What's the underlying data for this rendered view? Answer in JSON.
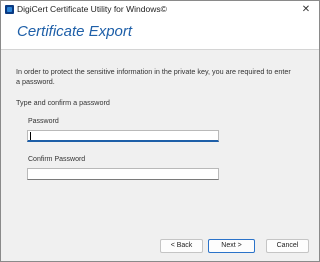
{
  "window": {
    "title": "DigiCert Certificate Utility for Windows©",
    "close_glyph": "✕"
  },
  "header": {
    "title": "Certificate Export"
  },
  "body": {
    "intro": "In order to protect the sensitive information in the private key, you are required to enter a password.",
    "instruction": "Type and confirm a password"
  },
  "form": {
    "password_label": "Password",
    "password_value": "",
    "confirm_label": "Confirm Password",
    "confirm_value": ""
  },
  "buttons": {
    "back": "< Back",
    "next": "Next >",
    "cancel": "Cancel"
  },
  "colors": {
    "accent": "#1e5fa8",
    "app_icon": "#0a3a82"
  },
  "icons": {
    "app": "digicert-app-icon",
    "close": "close-icon"
  }
}
